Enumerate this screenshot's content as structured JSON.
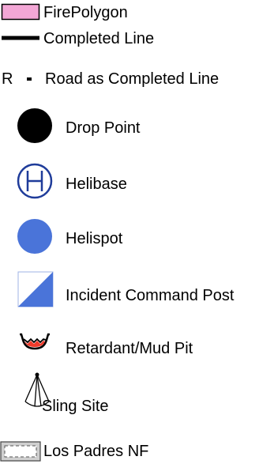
{
  "legend": {
    "items": [
      {
        "id": "fire-polygon",
        "label": "FirePolygon",
        "icon": "pink-rectangle-swatch-icon",
        "color": "#f3a7d6"
      },
      {
        "id": "completed-line",
        "label": "Completed Line",
        "icon": "thick-black-line-icon",
        "color": "#000000"
      },
      {
        "id": "road-completed",
        "prefix": "R",
        "label": "Road as Completed Line",
        "icon": "road-dash-icon",
        "color": "#000000"
      },
      {
        "id": "drop-point",
        "label": "Drop Point",
        "icon": "black-circle-icon",
        "color": "#000000"
      },
      {
        "id": "helibase",
        "label": "Helibase",
        "icon": "helibase-h-circle-icon",
        "color": "#1f3c9a"
      },
      {
        "id": "helispot",
        "label": "Helispot",
        "icon": "blue-circle-icon",
        "color": "#4a74d9"
      },
      {
        "id": "icp",
        "label": "Incident Command Post",
        "icon": "command-post-square-icon",
        "color": "#4a74d9"
      },
      {
        "id": "retardant-pit",
        "label": "Retardant/Mud Pit",
        "icon": "retardant-pit-icon",
        "color": "#ef3b2c"
      },
      {
        "id": "sling-site",
        "label": "Sling Site",
        "icon": "sling-site-icon",
        "color": "#000000"
      },
      {
        "id": "los-padres",
        "label": "Los Padres NF",
        "icon": "forest-boundary-icon",
        "color": "#777777"
      }
    ]
  }
}
